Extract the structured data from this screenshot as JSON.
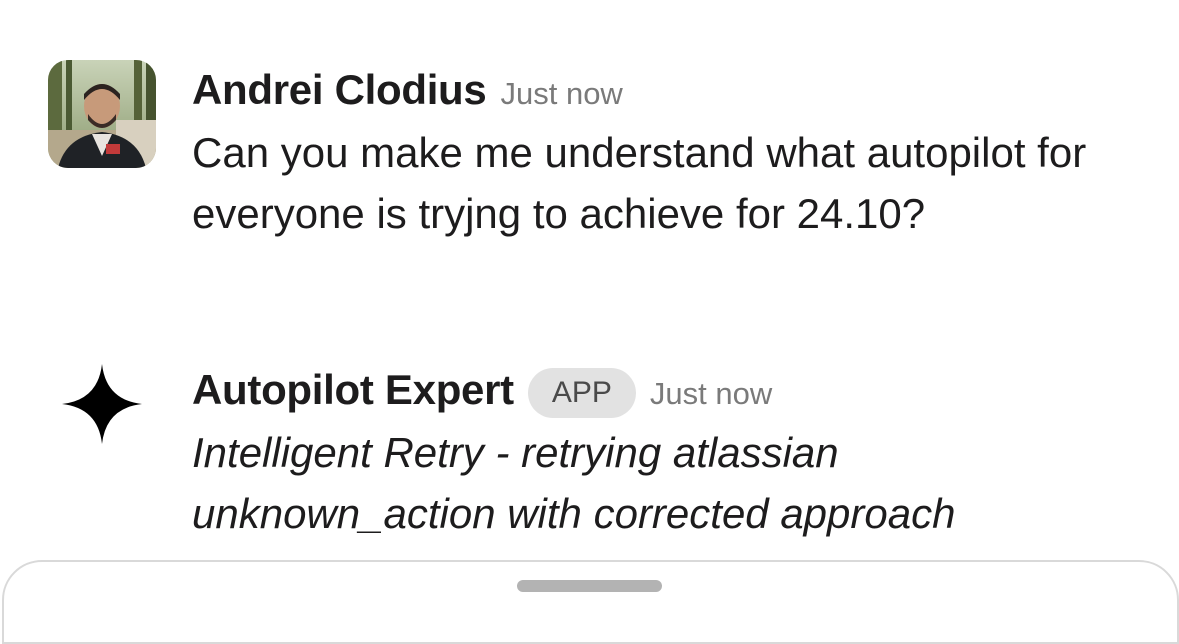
{
  "messages": [
    {
      "sender": "Andrei Clodius",
      "timestamp": "Just now",
      "avatar": "user-photo",
      "text": "Can you make me understand what autopilot for everyone is tryjng to achieve for 24.10?"
    },
    {
      "sender": "Autopilot Expert",
      "badge": "APP",
      "timestamp": "Just now",
      "avatar": "four-point-star-icon",
      "text": "Intelligent Retry - retrying atlassian unknown_action with corrected approach"
    }
  ],
  "colors": {
    "text": "#1d1c1d",
    "timestamp": "#7a7a7a",
    "badge_bg": "#e2e2e2",
    "badge_text": "#4a4a4a",
    "sheet_border": "#d9d9d9",
    "handle": "#b3b3b3"
  }
}
